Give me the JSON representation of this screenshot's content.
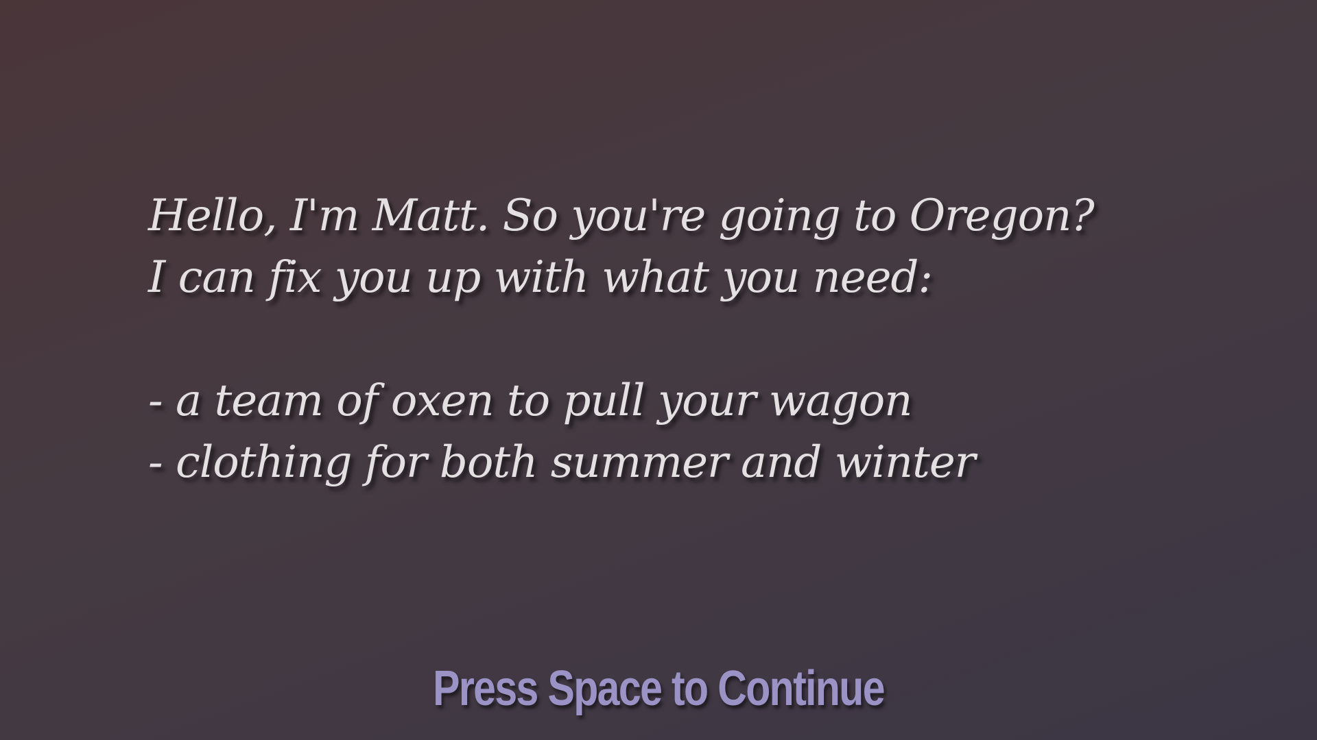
{
  "dialogue": {
    "line1": "Hello, I'm Matt. So you're going to Oregon?",
    "line2": "I can fix you up with what you need:",
    "items": [
      "- a team of oxen to pull your wagon",
      "- clothing for both summer and winter"
    ]
  },
  "prompt": {
    "label": "Press Space to Continue"
  },
  "colors": {
    "text": "#e4e0e2",
    "prompt": "#9b93c6",
    "background_top": "#4a3639",
    "background_bottom": "#3c3644"
  }
}
